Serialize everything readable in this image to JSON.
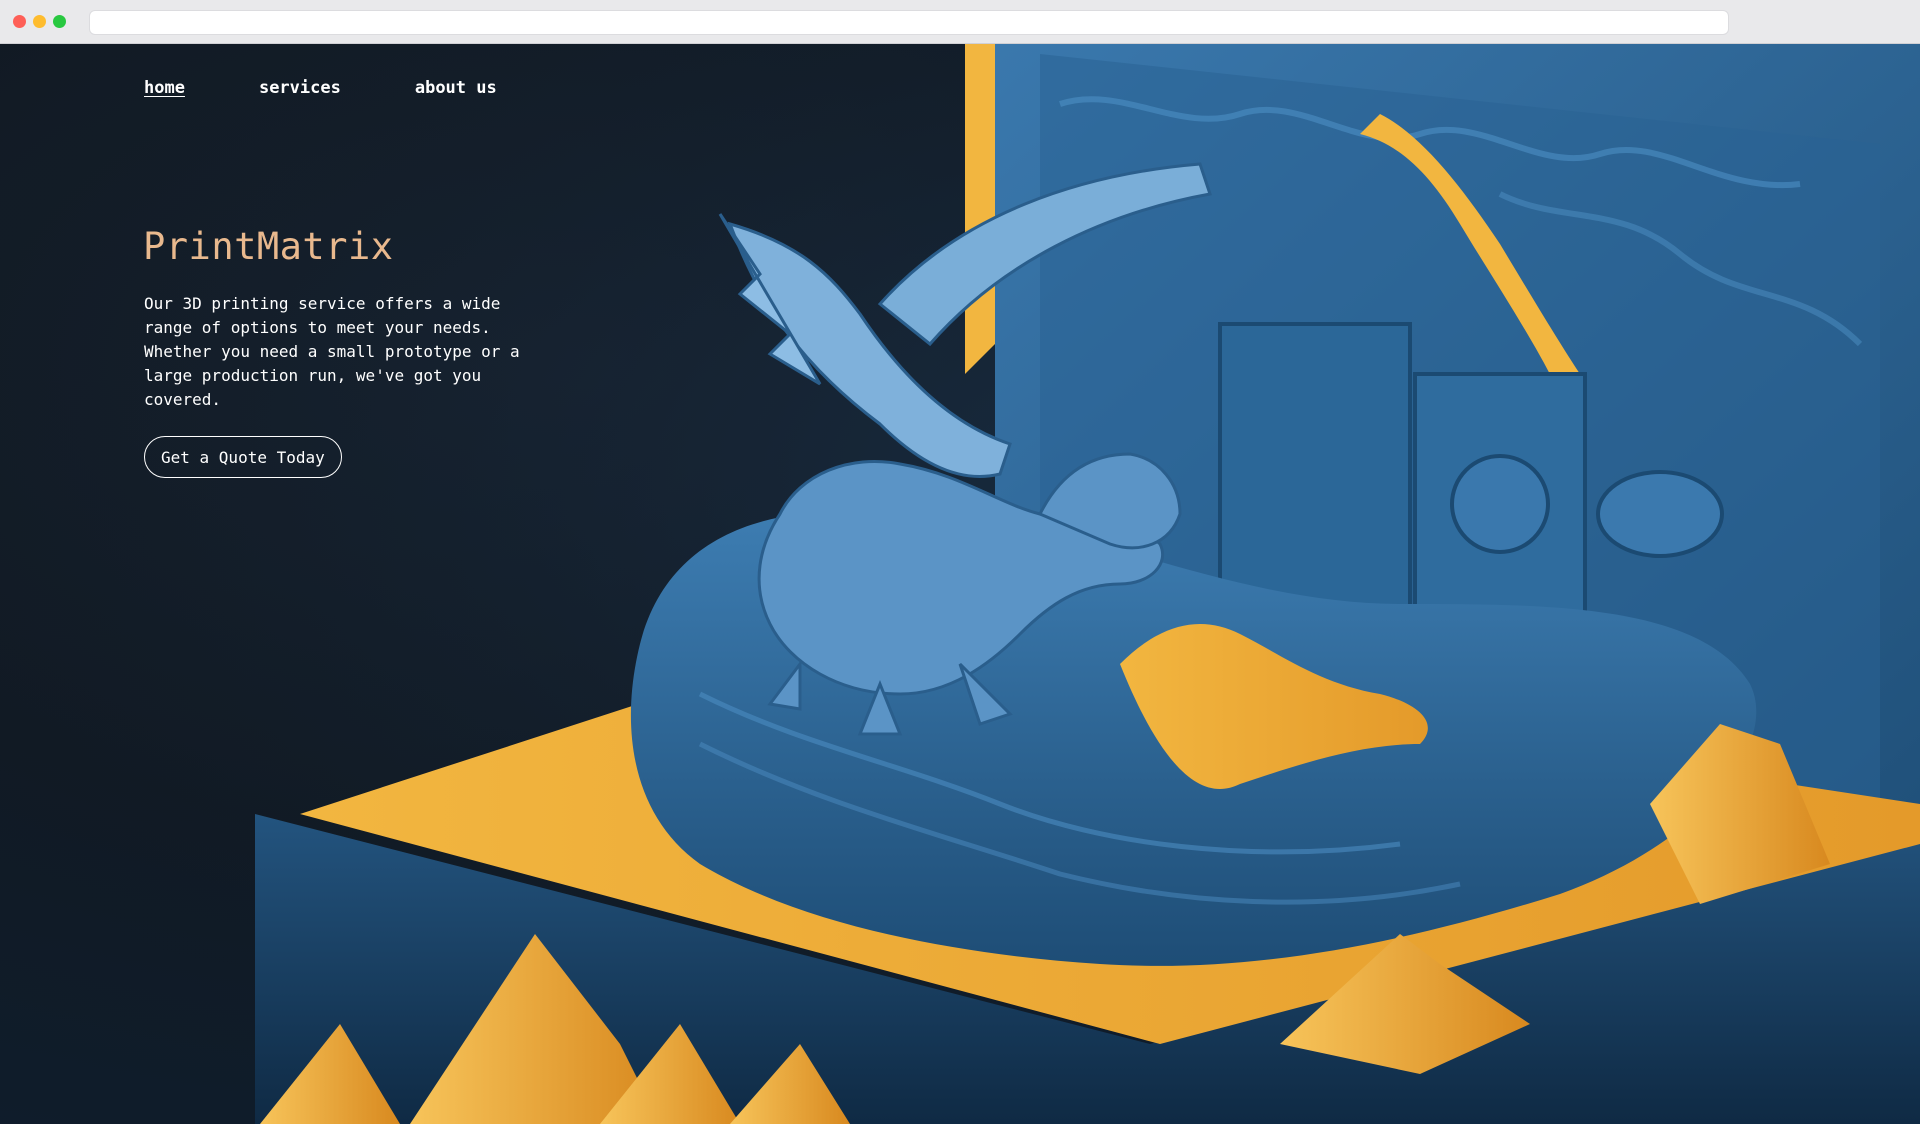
{
  "browser": {
    "url": ""
  },
  "nav": {
    "items": [
      {
        "label": "home",
        "active": true
      },
      {
        "label": "services",
        "active": false
      },
      {
        "label": "about us",
        "active": false
      }
    ]
  },
  "hero": {
    "title": "PrintMatrix",
    "description": "Our 3D printing service offers a wide range of options to meet your needs. Whether you need a small prototype or a large production run, we've got you covered.",
    "cta_label": "Get a Quote Today"
  },
  "colors": {
    "background": "#121b25",
    "title": "#e9b98e",
    "text": "#ffffff",
    "accent_blue": "#3e7fb4",
    "accent_yellow": "#f2b640"
  }
}
